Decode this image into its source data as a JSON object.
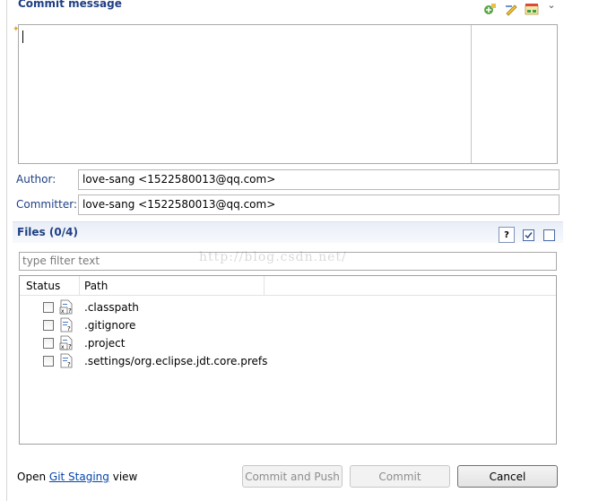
{
  "commit_message": {
    "title": "Commit message",
    "text": ""
  },
  "author": {
    "label": "Author:",
    "value": "love-sang <1522580013@qq.com>"
  },
  "committer": {
    "label": "Committer:",
    "value": "love-sang <1522580013@qq.com>"
  },
  "files": {
    "title": "Files (0/4)",
    "filter_placeholder": "type filter text",
    "columns": {
      "status": "Status",
      "path": "Path"
    },
    "rows": [
      {
        "path": ".classpath",
        "icon": "xml-file-icon",
        "checked": false
      },
      {
        "path": ".gitignore",
        "icon": "text-file-icon",
        "checked": false
      },
      {
        "path": ".project",
        "icon": "xml-file-icon",
        "checked": false
      },
      {
        "path": ".settings/org.eclipse.jdt.core.prefs",
        "icon": "text-file-icon",
        "checked": false
      }
    ]
  },
  "watermark": "http://blog.csdn.net/",
  "footer": {
    "prefix": "Open",
    "link": "Git Staging",
    "suffix": "view"
  },
  "buttons": {
    "commit_and_push": "Commit and Push",
    "commit": "Commit",
    "cancel": "Cancel"
  },
  "colors": {
    "section_title": "#1f3f84",
    "link": "#0645ad",
    "disabled_text": "#8d8d8d"
  }
}
